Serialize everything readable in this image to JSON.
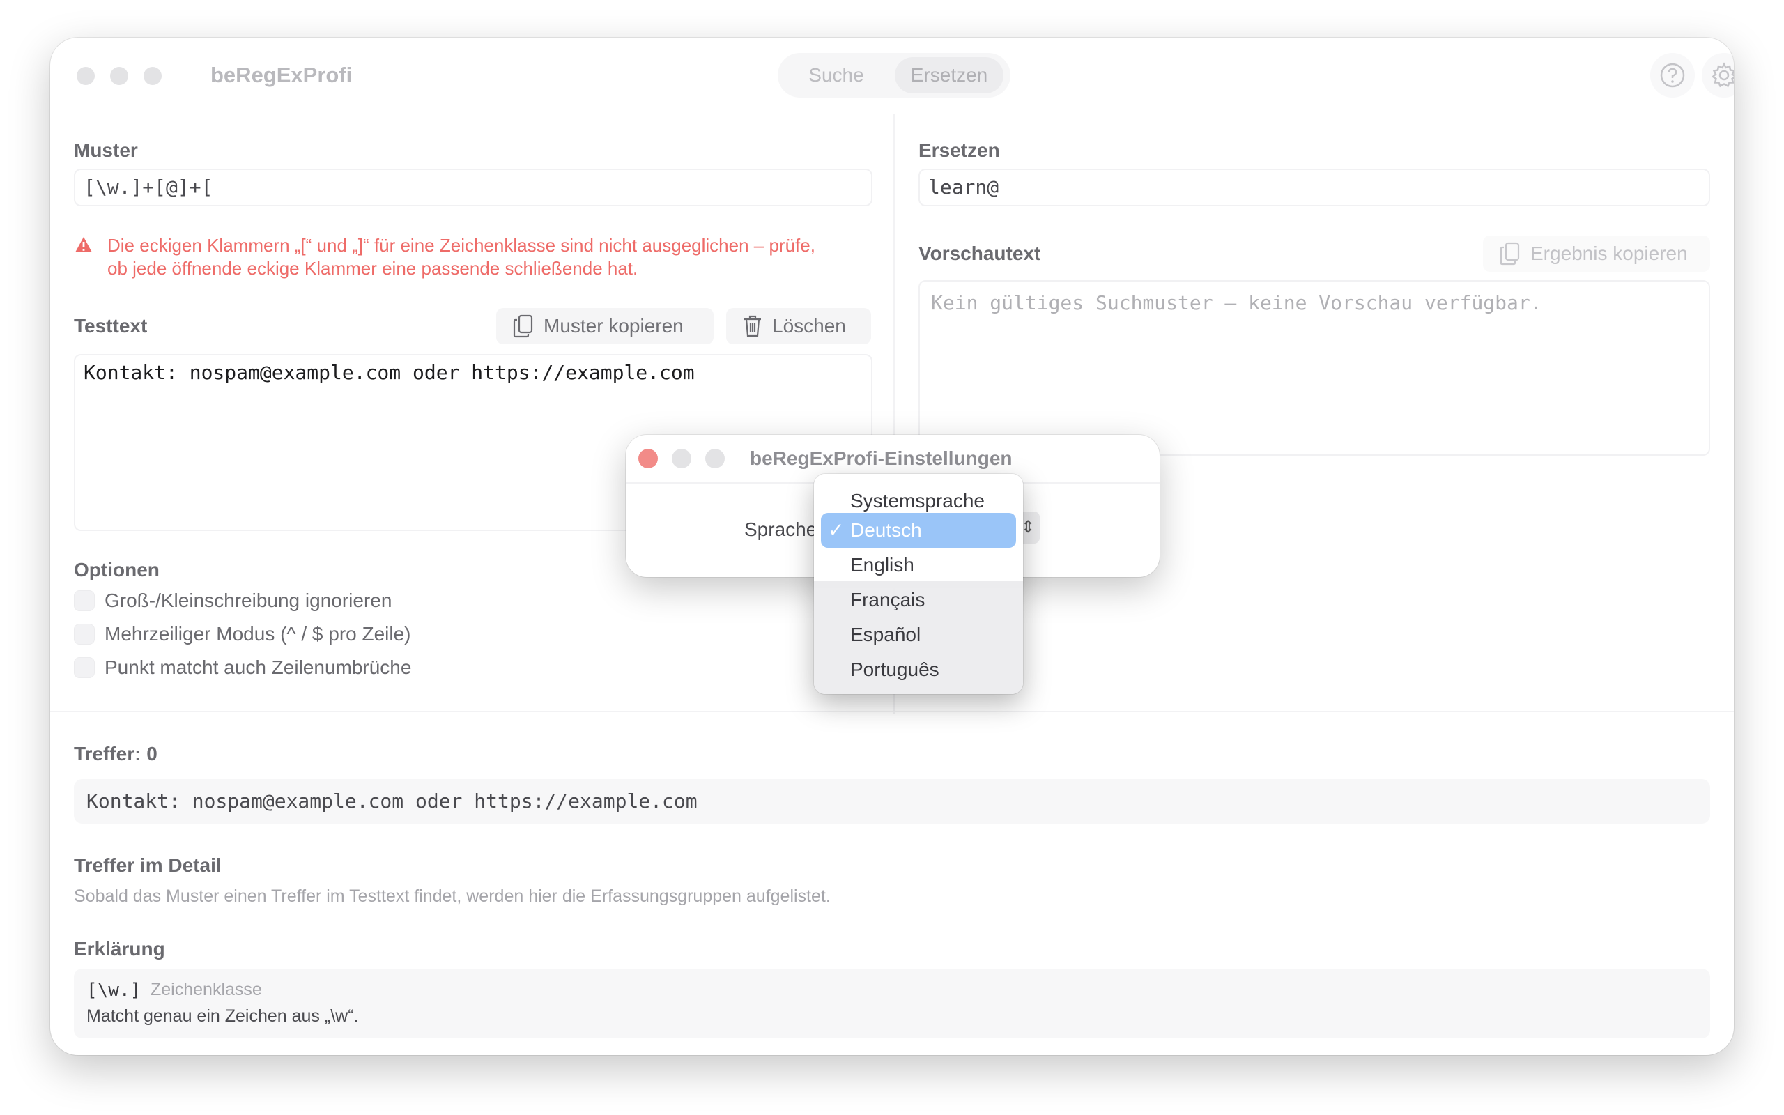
{
  "window": {
    "title": "beRegExProfi",
    "tabs": [
      {
        "label": "Suche",
        "active": false
      },
      {
        "label": "Ersetzen",
        "active": true
      }
    ],
    "toolbar_icons": [
      "help-icon",
      "gear-icon"
    ]
  },
  "left": {
    "pattern_label": "Muster",
    "pattern_value": "[\\w.]+[@]+[",
    "error_line1": "Die eckigen Klammern „[“ und „]“ für eine Zeichenklasse sind nicht ausgeglichen – prüfe,",
    "error_line2": "ob jede öffnende eckige Klammer eine passende schließende hat.",
    "testtext_label": "Testtext",
    "copy_pattern_button": "Muster kopieren",
    "delete_button": "Löschen",
    "testtext_value": "Kontakt: nospam@example.com oder https://example.com",
    "options_label": "Optionen",
    "options": [
      {
        "label": "Groß-/Kleinschreibung ignorieren",
        "checked": false
      },
      {
        "label": "Mehrzeiliger Modus (^ / $ pro Zeile)",
        "checked": false
      },
      {
        "label": "Punkt matcht auch Zeilenumbrüche",
        "checked": false
      }
    ]
  },
  "right": {
    "replace_label": "Ersetzen",
    "replace_value": "learn@",
    "preview_label": "Vorschautext",
    "copy_result_button": "Ergebnis kopieren",
    "preview_placeholder": "Kein gültiges Suchmuster – keine Vorschau verfügbar."
  },
  "bottom": {
    "matches_label": "Treffer: 0",
    "matches_text": "Kontakt: nospam@example.com oder https://example.com",
    "detail_label": "Treffer im Detail",
    "detail_text": "Sobald das Muster einen Treffer im Testtext findet, werden hier die Erfassungsgruppen aufgelistet.",
    "explain_label": "Erklärung",
    "explain_token": "[\\w.]",
    "explain_kind": "Zeichenklasse",
    "explain_desc": "Matcht genau ein Zeichen aus „\\w“."
  },
  "settings_dialog": {
    "title": "beRegExProfi-Einstellungen",
    "language_label": "Sprache",
    "popup_arrow": "⇕",
    "menu": [
      {
        "label": "Systemsprache",
        "selected": false
      },
      {
        "label": "Deutsch",
        "selected": true
      },
      {
        "label": "English",
        "selected": false
      },
      {
        "label": "Français",
        "selected": false
      },
      {
        "label": "Español",
        "selected": false
      },
      {
        "label": "Português",
        "selected": false
      }
    ],
    "check_mark": "✓"
  },
  "colors": {
    "accent": "#9ac5f8",
    "error": "#ee6b68",
    "close": "#f28b88"
  }
}
